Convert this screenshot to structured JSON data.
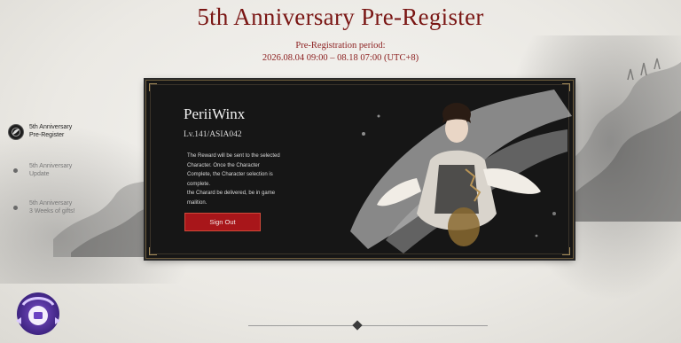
{
  "header": {
    "title": "5th Anniversary Pre-Register",
    "period_label": "Pre-Registration period:",
    "period_dates": "2026.08.04 09:00 – 08.18 07:00 (UTC+8)"
  },
  "side_nav": {
    "items": [
      {
        "line1": "5th Anniversary",
        "line2": "Pre-Register"
      },
      {
        "line1": "5th Anniversary",
        "line2": "Update"
      },
      {
        "line1": "5th Anniversary",
        "line2": "3 Weeks of gifts!"
      }
    ]
  },
  "panel": {
    "character_name": "PeriiWinx",
    "character_level": "Lv.141/ASIA042",
    "notice_lines": [
      "The Reward will be sent to the selected",
      "Character. Once the Character",
      "Complete, the Character selection is",
      "complete.",
      "the Charard be delivered, be in game",
      "malition."
    ],
    "signout_label": "Sign Out"
  },
  "colors": {
    "title": "#7a1614",
    "panel_bg": "#161616",
    "button": "#a8161a",
    "gold_trim": "#a38b5a"
  },
  "icons": {
    "active_nav": "brush-emblem-icon",
    "badge": "chat-bubble-badge-icon"
  }
}
